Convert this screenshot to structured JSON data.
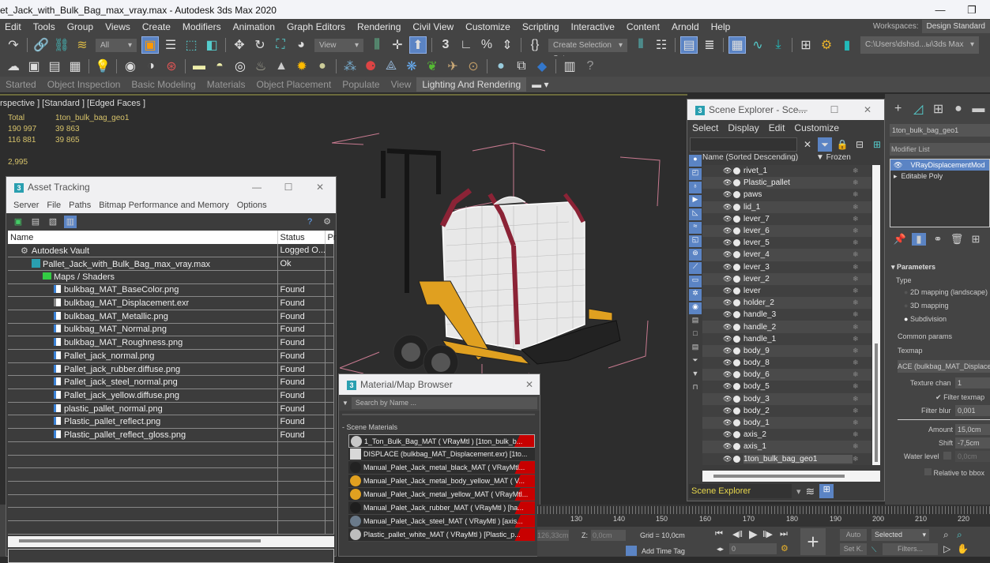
{
  "window": {
    "title": "et_Jack_with_Bulk_Bag_max_vray.max - Autodesk 3ds Max 2020",
    "minimize": "—",
    "restore": "❐"
  },
  "menubar": {
    "items": [
      "Edit",
      "Tools",
      "Group",
      "Views",
      "Create",
      "Modifiers",
      "Animation",
      "Graph Editors",
      "Rendering",
      "Civil View",
      "Customize",
      "Scripting",
      "Interactive",
      "Content",
      "Arnold",
      "Help"
    ],
    "workspaces_label": "Workspaces:",
    "workspaces_value": "Design Standard"
  },
  "toolbar": {
    "selection_filter": "All",
    "ref_coord": "View",
    "selection_set": "Create Selection Set",
    "project_path": "C:\\Users\\dshsd...ы\\3ds Max 2020"
  },
  "ribbon": {
    "tabs": [
      "Started",
      "Object Inspection",
      "Basic Modeling",
      "Materials",
      "Object Placement",
      "Populate",
      "View",
      "Lighting And Rendering"
    ],
    "active": "Lighting And Rendering"
  },
  "viewport": {
    "label": "rspective ] [Standard ] [Edged Faces ]",
    "stats": {
      "col1_header": "Total",
      "col2_header": "1ton_bulk_bag_geo1",
      "polys_total": "190 997",
      "polys_obj": "39 863",
      "verts_total": "116 881",
      "verts_obj": "39 865",
      "fps": "2,995"
    }
  },
  "asset_tracking": {
    "title": "Asset Tracking",
    "menu": [
      "Server",
      "File",
      "Paths",
      "Bitmap Performance and Memory",
      "Options"
    ],
    "columns": [
      "Name",
      "Status",
      "Pr"
    ],
    "rows": [
      {
        "name": "Autodesk Vault",
        "status": "Logged O...",
        "indent": 1,
        "icon": "vault-icon"
      },
      {
        "name": "Pallet_Jack_with_Bulk_Bag_max_vray.max",
        "status": "Ok",
        "indent": 2,
        "icon": "max-file-icon"
      },
      {
        "name": "Maps / Shaders",
        "status": "",
        "indent": 3,
        "icon": "maps-folder-icon"
      },
      {
        "name": "bulkbag_MAT_BaseColor.png",
        "status": "Found",
        "indent": 4,
        "icon": "image-file-icon"
      },
      {
        "name": "bulkbag_MAT_Displacement.exr",
        "status": "Found",
        "indent": 4,
        "icon": "exr-file-icon"
      },
      {
        "name": "bulkbag_MAT_Metallic.png",
        "status": "Found",
        "indent": 4,
        "icon": "image-file-icon"
      },
      {
        "name": "bulkbag_MAT_Normal.png",
        "status": "Found",
        "indent": 4,
        "icon": "image-file-icon"
      },
      {
        "name": "bulkbag_MAT_Roughness.png",
        "status": "Found",
        "indent": 4,
        "icon": "image-file-icon"
      },
      {
        "name": "Pallet_jack_normal.png",
        "status": "Found",
        "indent": 4,
        "icon": "image-file-icon"
      },
      {
        "name": "Pallet_jack_rubber.diffuse.png",
        "status": "Found",
        "indent": 4,
        "icon": "image-file-icon"
      },
      {
        "name": "Pallet_jack_steel_normal.png",
        "status": "Found",
        "indent": 4,
        "icon": "image-file-icon"
      },
      {
        "name": "Pallet_jack_yellow.diffuse.png",
        "status": "Found",
        "indent": 4,
        "icon": "image-file-icon"
      },
      {
        "name": "plastic_pallet_normal.png",
        "status": "Found",
        "indent": 4,
        "icon": "image-file-icon"
      },
      {
        "name": "Plastic_pallet_reflect.png",
        "status": "Found",
        "indent": 4,
        "icon": "image-file-icon"
      },
      {
        "name": "Plastic_pallet_reflect_gloss.png",
        "status": "Found",
        "indent": 4,
        "icon": "image-file-icon"
      }
    ]
  },
  "material_browser": {
    "title": "Material/Map Browser",
    "search_placeholder": "Search by Name ...",
    "section": "- Scene Materials",
    "materials": [
      {
        "label": "1_Ton_Bulk_Bag_MAT  ( VRayMtl )  [1ton_bulk_b...",
        "swatch": "#c8c8c8"
      },
      {
        "label": "DISPLACE (bulkbag_MAT_Displacement.exr)  [1to...",
        "swatch": "#d8d8d8"
      },
      {
        "label": "Manual_Palet_Jack_metal_black_MAT   ( VRayMtl...",
        "swatch": "#222222"
      },
      {
        "label": "Manual_Palet_Jack_metal_body_yellow_MAT   ( V...",
        "swatch": "#e0a020"
      },
      {
        "label": "Manual_Palet_Jack_metal_yellow_MAT   ( VRayMtl...",
        "swatch": "#e0a020"
      },
      {
        "label": "Manual_Palet_Jack_rubber_MAT   ( VRayMtl )  [ha...",
        "swatch": "#1e1e1e"
      },
      {
        "label": "Manual_Palet_Jack_steel_MAT   ( VRayMtl )  [axis...",
        "swatch": "#6a7a8a"
      },
      {
        "label": "Plastic_pallet_white_MAT   ( VRayMtl )  [Plastic_p...",
        "swatch": "#bdbdbd"
      }
    ]
  },
  "scene_explorer": {
    "title": "Scene Explorer - Sce...",
    "menu": [
      "Select",
      "Display",
      "Edit",
      "Customize"
    ],
    "col_name": "Name (Sorted Descending)",
    "col_frozen": "▼ Frozen",
    "objects": [
      "rivet_1",
      "Plastic_pallet",
      "paws",
      "lid_1",
      "lever_7",
      "lever_6",
      "lever_5",
      "lever_4",
      "lever_3",
      "lever_2",
      "lever",
      "holder_2",
      "handle_3",
      "handle_2",
      "handle_1",
      "body_9",
      "body_8",
      "body_6",
      "body_5",
      "body_3",
      "body_2",
      "body_1",
      "axis_2",
      "axis_1",
      "1ton_bulk_bag_geo1"
    ],
    "selected": "1ton_bulk_bag_geo1",
    "footer_dropdown": "Scene Explorer"
  },
  "command_panel": {
    "object_name": "1ton_bulk_bag_geo1",
    "modifier_list": "Modifier List",
    "stack": [
      "VRayDisplacementMod",
      "Editable Poly"
    ],
    "parameters_title": "Parameters",
    "type_label": "Type",
    "type_options": [
      "2D mapping (landscape)",
      "3D mapping",
      "Subdivision"
    ],
    "type_selected": "Subdivision",
    "common_params": "Common params",
    "texmap_label": "Texmap",
    "texmap_value": "ACE (bulkbag_MAT_Displacen",
    "texture_chan_label": "Texture chan",
    "texture_chan_value": "1",
    "filter_texmap_label": "Filter texmap",
    "filter_texmap_checked": true,
    "filter_blur_label": "Filter blur",
    "filter_blur_value": "0,001",
    "amount_label": "Amount",
    "amount_value": "15,0cm",
    "shift_label": "Shift",
    "shift_value": "-7,5cm",
    "water_level_label": "Water level",
    "water_level_value": "0,0cm",
    "relative_bbox_label": "Relative to bbox"
  },
  "timeline": {
    "ticks": [
      "130",
      "140",
      "150",
      "160",
      "170",
      "180",
      "190",
      "200",
      "210",
      "220"
    ]
  },
  "statusbar": {
    "x_value": "126,33cm",
    "z_label": "Z:",
    "z_value": "0,0cm",
    "grid": "Grid = 10,0cm",
    "add_time_tag": "Add Time Tag",
    "frame": "0",
    "auto": "Auto",
    "set_key": "Set K.",
    "key_filter": "Selected",
    "filters": "Filters..."
  }
}
